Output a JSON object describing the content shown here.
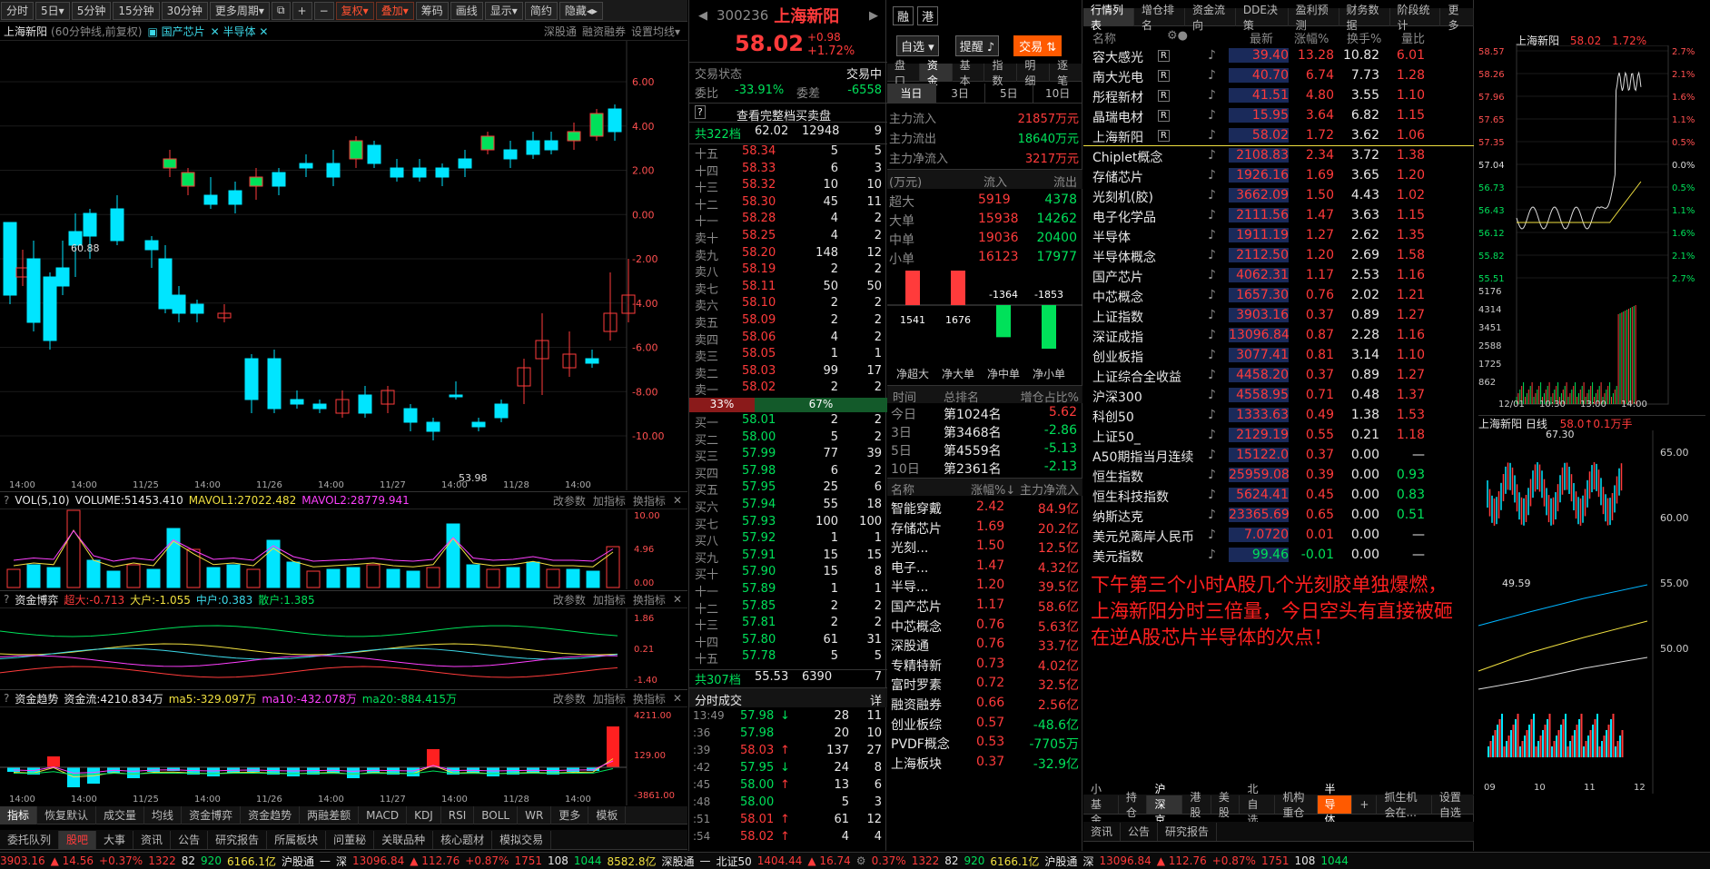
{
  "topbar": [
    "分时",
    "5日",
    "5分钟",
    "15分钟",
    "30分钟",
    "更多周期",
    "复权",
    "叠加",
    "筹码",
    "画线",
    "显示",
    "简约",
    "隐藏"
  ],
  "chart_header": {
    "name": "上海新阳",
    "meta": "(60分钟线,前复权)",
    "tag1": "国产芯片",
    "tag2": "半导体",
    "links": [
      "深股通",
      "融资融券",
      "设置均线"
    ]
  },
  "kline": {
    "yticks": [
      "6.00",
      "4.00",
      "2.00",
      "0.00",
      "-2.00",
      "-4.00",
      "-6.00",
      "-8.00",
      "-10.00"
    ],
    "max_label": "60.88",
    "min_label": "53.98",
    "xticks": [
      "14:00",
      "14:00",
      "11/25",
      "14:00",
      "11/26",
      "14:00",
      "11/27",
      "14:00",
      "11/28",
      "14:00"
    ]
  },
  "vol_panel": {
    "title": "VOL(5,10)",
    "volume": "VOLUME:51453.410",
    "ma1": "MAVOL1:27022.482",
    "ma2": "MAVOL2:28779.941",
    "btns": [
      "改参数",
      "加指标",
      "换指标"
    ],
    "yticks": [
      "10.00",
      "4.96",
      "0.00"
    ]
  },
  "zjby_panel": {
    "title": "资金博弈",
    "v1": "超大:-0.713",
    "v2": "大户:-1.055",
    "v3": "中户:0.383",
    "v4": "散户:1.385",
    "btns": [
      "改参数",
      "加指标",
      "换指标"
    ],
    "yticks": [
      "1.86",
      "0.21",
      "-1.40"
    ]
  },
  "zjqs_panel": {
    "title": "资金趋势",
    "v1": "资金流:4210.834万",
    "v2": "ma5:-329.097万",
    "v3": "ma10:-432.078万",
    "v4": "ma20:-884.415万",
    "btns": [
      "改参数",
      "加指标",
      "换指标"
    ],
    "yticks": [
      "4211.00",
      "129.00",
      "-3861.00"
    ]
  },
  "bottom_tabs": [
    "指标",
    "恢复默认",
    "成交量",
    "均线",
    "资金博弈",
    "资金趋势",
    "两融差额",
    "MACD",
    "KDJ",
    "RSI",
    "BOLL",
    "WR",
    "更多",
    "模板"
  ],
  "bottom_tabs2": [
    "委托队列",
    "股吧",
    "大事",
    "资讯",
    "公告",
    "研究报告",
    "所属板块",
    "问董秘",
    "关联品种",
    "核心题材",
    "模拟交易"
  ],
  "stock": {
    "code": "300236",
    "name": "上海新阳",
    "price": "58.02",
    "chg": "+0.98",
    "pct": "+1.72%",
    "btns": [
      "融",
      "港"
    ],
    "select": "自选",
    "remind": "提醒",
    "trade": "交易"
  },
  "orderbook": {
    "status_label": "交易状态",
    "status": "交易中",
    "weibi_label": "委比",
    "weibi": "-33.91%",
    "weicha_label": "委差",
    "weicha": "-6558",
    "full_link": "查看完整档买卖盘",
    "sell_total": {
      "label": "共322档",
      "price": "62.02",
      "vol": "12948",
      "n": "9"
    },
    "sells": [
      {
        "l": "十五",
        "p": "58.34",
        "v": "5",
        "n": "5"
      },
      {
        "l": "十四",
        "p": "58.33",
        "v": "6",
        "n": "3"
      },
      {
        "l": "十三",
        "p": "58.32",
        "v": "10",
        "n": "10"
      },
      {
        "l": "十二",
        "p": "58.30",
        "v": "45",
        "n": "11"
      },
      {
        "l": "十一",
        "p": "58.28",
        "v": "4",
        "n": "2"
      },
      {
        "l": "卖十",
        "p": "58.25",
        "v": "4",
        "n": "2"
      },
      {
        "l": "卖九",
        "p": "58.20",
        "v": "148",
        "n": "12"
      },
      {
        "l": "卖八",
        "p": "58.19",
        "v": "2",
        "n": "2"
      },
      {
        "l": "卖七",
        "p": "58.11",
        "v": "50",
        "n": "50"
      },
      {
        "l": "卖六",
        "p": "58.10",
        "v": "2",
        "n": "2"
      },
      {
        "l": "卖五",
        "p": "58.09",
        "v": "2",
        "n": "2"
      },
      {
        "l": "卖四",
        "p": "58.06",
        "v": "4",
        "n": "2"
      },
      {
        "l": "卖三",
        "p": "58.05",
        "v": "1",
        "n": "1"
      },
      {
        "l": "卖二",
        "p": "58.03",
        "v": "99",
        "n": "17"
      },
      {
        "l": "卖一",
        "p": "58.02",
        "v": "2",
        "n": "2"
      }
    ],
    "ratio_buy": "33%",
    "ratio_sell": "67%",
    "buys": [
      {
        "l": "买一",
        "p": "58.01",
        "v": "2",
        "n": "2"
      },
      {
        "l": "买二",
        "p": "58.00",
        "v": "5",
        "n": "2"
      },
      {
        "l": "买三",
        "p": "57.99",
        "v": "77",
        "n": "39"
      },
      {
        "l": "买四",
        "p": "57.98",
        "v": "6",
        "n": "2"
      },
      {
        "l": "买五",
        "p": "57.95",
        "v": "25",
        "n": "6"
      },
      {
        "l": "买六",
        "p": "57.94",
        "v": "55",
        "n": "18"
      },
      {
        "l": "买七",
        "p": "57.93",
        "v": "100",
        "n": "100"
      },
      {
        "l": "买八",
        "p": "57.92",
        "v": "1",
        "n": "1"
      },
      {
        "l": "买九",
        "p": "57.91",
        "v": "15",
        "n": "15"
      },
      {
        "l": "买十",
        "p": "57.90",
        "v": "15",
        "n": "8"
      },
      {
        "l": "十一",
        "p": "57.89",
        "v": "1",
        "n": "1"
      },
      {
        "l": "十二",
        "p": "57.85",
        "v": "2",
        "n": "2"
      },
      {
        "l": "十三",
        "p": "57.81",
        "v": "2",
        "n": "2"
      },
      {
        "l": "十四",
        "p": "57.80",
        "v": "61",
        "n": "31"
      },
      {
        "l": "十五",
        "p": "57.78",
        "v": "5",
        "n": "5"
      }
    ],
    "buy_total": {
      "label": "共307档",
      "price": "55.53",
      "vol": "6390",
      "n": "7"
    }
  },
  "ticks": {
    "title": "分时成交",
    "btn": "详",
    "rows": [
      {
        "t": "13:49",
        "p": "57.98",
        "d": "↓",
        "v": "28",
        "n": "11"
      },
      {
        "t": ":36",
        "p": "57.98",
        "d": "",
        "v": "20",
        "n": "10"
      },
      {
        "t": ":39",
        "p": "58.03",
        "d": "↑",
        "v": "137",
        "n": "27"
      },
      {
        "t": ":42",
        "p": "57.95",
        "d": "↓",
        "v": "24",
        "n": "8"
      },
      {
        "t": ":45",
        "p": "58.00",
        "d": "↑",
        "v": "13",
        "n": "6"
      },
      {
        "t": ":48",
        "p": "58.00",
        "d": "",
        "v": "5",
        "n": "3"
      },
      {
        "t": ":51",
        "p": "58.01",
        "d": "↑",
        "v": "61",
        "n": "12"
      },
      {
        "t": ":54",
        "p": "58.02",
        "d": "↑",
        "v": "4",
        "n": "4"
      }
    ]
  },
  "flow": {
    "tabs": [
      "盘口",
      "资金",
      "基本",
      "指数",
      "明细",
      "逐笔"
    ],
    "period_tabs": [
      "当日",
      "3日",
      "5日",
      "10日"
    ],
    "main_in_label": "主力流入",
    "main_in": "21857万元",
    "main_out_label": "主力流出",
    "main_out": "18640万元",
    "main_net_label": "主力净流入",
    "main_net": "3217万元",
    "unit": "(万元)",
    "col_in": "流入",
    "col_out": "流出",
    "rows": [
      {
        "l": "超大",
        "i": "5919",
        "o": "4378"
      },
      {
        "l": "大单",
        "i": "15938",
        "o": "14262"
      },
      {
        "l": "中单",
        "i": "19036",
        "o": "20400"
      },
      {
        "l": "小单",
        "i": "16123",
        "o": "17977"
      }
    ],
    "bars": [
      {
        "l": "净超大",
        "v": "1541"
      },
      {
        "l": "净大单",
        "v": "1676"
      },
      {
        "l": "净中单",
        "v": "-1364"
      },
      {
        "l": "净小单",
        "v": "-1853"
      }
    ],
    "rank_head": [
      "时间",
      "总排名",
      "增仓占比%"
    ],
    "ranks": [
      {
        "t": "今日",
        "r": "第1024名",
        "v": "5.62"
      },
      {
        "t": "3日",
        "r": "第3468名",
        "v": "-2.86"
      },
      {
        "t": "5日",
        "r": "第4559名",
        "v": "-5.13"
      },
      {
        "t": "10日",
        "r": "第2361名",
        "v": "-2.13"
      }
    ],
    "concept_head": [
      "名称",
      "涨幅%↓",
      "主力净流入"
    ],
    "concepts": [
      {
        "n": "智能穿戴",
        "p": "2.42",
        "f": "84.9亿"
      },
      {
        "n": "存储芯片",
        "p": "1.69",
        "f": "20.2亿"
      },
      {
        "n": "光刻...",
        "p": "1.50",
        "f": "12.5亿"
      },
      {
        "n": "电子...",
        "p": "1.47",
        "f": "4.32亿"
      },
      {
        "n": "半导...",
        "p": "1.20",
        "f": "39.5亿"
      },
      {
        "n": "国产芯片",
        "p": "1.17",
        "f": "58.6亿"
      },
      {
        "n": "中芯概念",
        "p": "0.76",
        "f": "5.63亿"
      },
      {
        "n": "深股通",
        "p": "0.76",
        "f": "33.7亿"
      },
      {
        "n": "专精特新",
        "p": "0.73",
        "f": "4.02亿"
      },
      {
        "n": "富时罗素",
        "p": "0.72",
        "f": "32.5亿"
      },
      {
        "n": "融资融券",
        "p": "0.66",
        "f": "2.56亿"
      },
      {
        "n": "创业板综",
        "p": "0.57",
        "f": "-48.6亿"
      },
      {
        "n": "PVDF概念",
        "p": "0.53",
        "f": "-7705万"
      },
      {
        "n": "上海板块",
        "p": "0.37",
        "f": "-32.9亿"
      }
    ]
  },
  "quotes": {
    "tabs": [
      "行情列表",
      "增仓排名",
      "资金流向",
      "DDE决策",
      "盈利预测",
      "财务数据",
      "阶段统计",
      "更多"
    ],
    "head": [
      "名称",
      "最新",
      "涨幅%",
      "换手%",
      "量比"
    ],
    "rows": [
      {
        "n": "容大感光",
        "b": "R",
        "p": "39.40",
        "c": "13.28",
        "h": "10.82",
        "r": "6.01"
      },
      {
        "n": "南大光电",
        "b": "R",
        "p": "40.70",
        "c": "6.74",
        "h": "7.73",
        "r": "1.28"
      },
      {
        "n": "彤程新材",
        "b": "R",
        "p": "41.51",
        "c": "4.80",
        "h": "3.55",
        "r": "1.10"
      },
      {
        "n": "晶瑞电材",
        "b": "R",
        "p": "15.95",
        "c": "3.64",
        "h": "6.82",
        "r": "1.15"
      },
      {
        "n": "上海新阳",
        "b": "R",
        "p": "58.02",
        "c": "1.72",
        "h": "3.62",
        "r": "1.06"
      },
      {
        "n": "Chiplet概念",
        "b": "",
        "p": "2108.83",
        "c": "2.34",
        "h": "3.72",
        "r": "1.38"
      },
      {
        "n": "存储芯片",
        "b": "",
        "p": "1926.16",
        "c": "1.69",
        "h": "3.65",
        "r": "1.20"
      },
      {
        "n": "光刻机(胶)",
        "b": "",
        "p": "3662.09",
        "c": "1.50",
        "h": "4.43",
        "r": "1.02"
      },
      {
        "n": "电子化学品",
        "b": "",
        "p": "2111.56",
        "c": "1.47",
        "h": "3.63",
        "r": "1.15"
      },
      {
        "n": "半导体",
        "b": "",
        "p": "1911.19",
        "c": "1.27",
        "h": "2.62",
        "r": "1.35"
      },
      {
        "n": "半导体概念",
        "b": "",
        "p": "2112.50",
        "c": "1.20",
        "h": "2.69",
        "r": "1.58"
      },
      {
        "n": "国产芯片",
        "b": "",
        "p": "4062.31",
        "c": "1.17",
        "h": "2.53",
        "r": "1.16"
      },
      {
        "n": "中芯概念",
        "b": "",
        "p": "1657.30",
        "c": "0.76",
        "h": "2.02",
        "r": "1.21"
      },
      {
        "n": "上证指数",
        "b": "",
        "p": "3903.16",
        "c": "0.37",
        "h": "0.89",
        "r": "1.27"
      },
      {
        "n": "深证成指",
        "b": "",
        "p": "13096.84",
        "c": "0.87",
        "h": "2.28",
        "r": "1.16"
      },
      {
        "n": "创业板指",
        "b": "",
        "p": "3077.41",
        "c": "0.81",
        "h": "3.14",
        "r": "1.10"
      },
      {
        "n": "上证综合全收益",
        "b": "",
        "p": "4458.20",
        "c": "0.37",
        "h": "0.89",
        "r": "1.27"
      },
      {
        "n": "沪深300",
        "b": "",
        "p": "4558.95",
        "c": "0.71",
        "h": "0.48",
        "r": "1.37"
      },
      {
        "n": "科创50",
        "b": "",
        "p": "1333.63",
        "c": "0.49",
        "h": "1.38",
        "r": "1.53"
      },
      {
        "n": "上证50_",
        "b": "",
        "p": "2129.19",
        "c": "0.55",
        "h": "0.21",
        "r": "1.18"
      },
      {
        "n": "A50期指当月连续",
        "b": "",
        "p": "15122.0",
        "c": "0.37",
        "h": "0.00",
        "r": "—"
      },
      {
        "n": "恒生指数",
        "b": "",
        "p": "25959.08",
        "c": "0.39",
        "h": "0.00",
        "r": "0.93"
      },
      {
        "n": "恒生科技指数",
        "b": "",
        "p": "5624.41",
        "c": "0.45",
        "h": "0.00",
        "r": "0.83"
      },
      {
        "n": "纳斯达克",
        "b": "",
        "p": "23365.69",
        "c": "0.65",
        "h": "0.00",
        "r": "0.51"
      },
      {
        "n": "美元兑离岸人民币",
        "b": "",
        "p": "7.0720",
        "c": "0.01",
        "h": "0.00",
        "r": "—"
      },
      {
        "n": "美元指数",
        "b": "",
        "p": "99.46",
        "c": "-0.01",
        "h": "0.00",
        "r": "—"
      }
    ],
    "annotation": "下午第三个小时A股几个光刻胶单独爆燃，上海新阳分时三倍量，今日空头有直接被砸在逆A股芯片半导体的次点！",
    "bottom_tabs": [
      "小基金",
      "持仓",
      "沪深京",
      "港股",
      "美股",
      "北自选",
      "机构重仓",
      "半导体",
      "+",
      "抓生机会在...",
      "设置自选"
    ],
    "bottom_tabs2": [
      "资讯",
      "公告",
      "研究报告"
    ]
  },
  "mini": {
    "name": "上海新阳",
    "price": "58.02",
    "pct": "1.72%",
    "price_ticks": [
      "58.57",
      "58.26",
      "57.96",
      "57.65",
      "57.35",
      "57.04",
      "56.73",
      "56.43",
      "56.12",
      "55.82",
      "55.51"
    ],
    "pct_ticks": [
      "2.7%",
      "2.1%",
      "1.6%",
      "1.1%",
      "0.5%",
      "0.0%",
      "0.5%",
      "1.1%",
      "1.6%",
      "2.1%",
      "2.7%"
    ],
    "vol_ticks": [
      "5176",
      "4314",
      "3451",
      "2588",
      "1725",
      "862"
    ],
    "times": [
      "12/01",
      "10:30",
      "13:00",
      "14:00"
    ],
    "daily_title": "上海新阳 日线",
    "daily_meta": "58.0↑0.1万手",
    "daily_max": "67.30",
    "daily_min": "49.59",
    "daily_ticks": [
      "65.00",
      "60.00",
      "55.00",
      "50.00"
    ],
    "daily_x": [
      "09",
      "10",
      "11",
      "12"
    ]
  },
  "statusbar": {
    "sh": "3903.16",
    "sh_chg": "▲ 14.56",
    "sh_pct": "+0.37%",
    "sh_v": "1322",
    "sh_n": "82",
    "sh_n2": "920",
    "sh_amt": "6166.1亿",
    "hgt": "沪股通",
    "hgt_v": "—",
    "sz_label": "深",
    "sz": "13096.84",
    "sz_chg": "▲ 112.76",
    "sz_pct": "+0.87%",
    "sz_v": "1751",
    "sz_n": "108",
    "sz_n2": "1044",
    "sz_amt": "8582.8亿",
    "sgt": "深股通",
    "sgt_v": "—",
    "bz_label": "北证50",
    "bz": "1404.44",
    "bz_chg": "▲ 16.74",
    "r_pct": "0.37%",
    "r_v": "1322",
    "r_n": "82",
    "r_n2": "920",
    "r_amt": "6166.1亿",
    "r_hgt": "沪股通",
    "r_sz_label": "深",
    "r_sz": "13096.84",
    "r_sz_chg": "▲ 112.76",
    "r_sz_pct": "+0.87%",
    "r_sz_v": "1751",
    "r_sz_n": "108",
    "r_sz_n2": "1044"
  },
  "colors": {
    "up": "#ff3b3b",
    "down": "#00e15a",
    "candle_up_fill": "#00e15a",
    "candle_down": "#00e5ff",
    "accent": "#ff5a00",
    "bg": "#000000"
  }
}
